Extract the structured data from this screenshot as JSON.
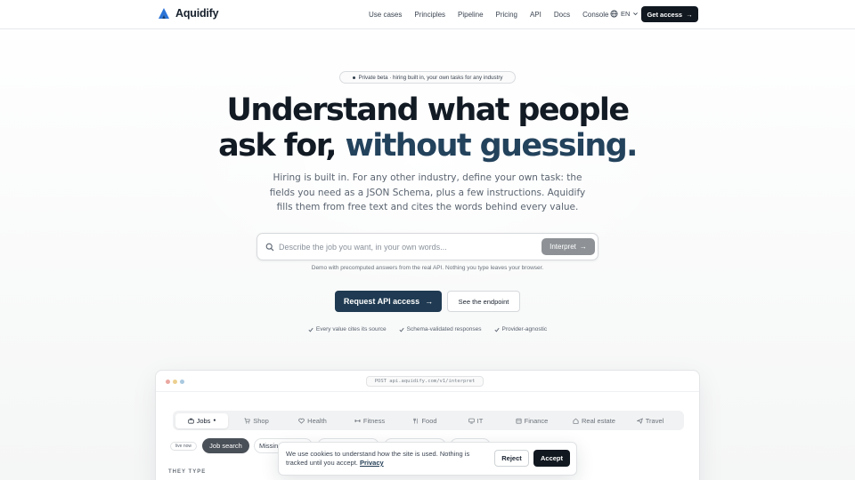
{
  "brand": {
    "name": "Aquidify",
    "color": "#2a74d8"
  },
  "nav": {
    "links": [
      "Use cases",
      "Principles",
      "Pipeline",
      "Pricing",
      "API",
      "Docs",
      "Console"
    ],
    "language": "EN",
    "cta": "Get access"
  },
  "hero": {
    "badge": "Private beta · hiring built in, your own tasks for any industry",
    "title_line1": "Understand what people",
    "title_line2_plain": "ask for, ",
    "title_line2_accent": "without guessing.",
    "subtitle": "Hiring is built in. For any other industry, define your own task: the fields you need as a JSON Schema, plus a few instructions. Aquidify fills them from free text and cites the words behind every value.",
    "search_placeholder": "Describe the job you want, in your own words...",
    "interpret_label": "Interpret",
    "demo_note": "Demo with precomputed answers from the real API. Nothing you type leaves your browser.",
    "primary_cta": "Request API access",
    "secondary_cta": "See the endpoint",
    "checks": [
      "Every value cites its source",
      "Schema-validated responses",
      "Provider-agnostic"
    ]
  },
  "demo": {
    "endpoint": "POST api.aquidify.com/v1/interpret",
    "tabs": [
      {
        "label": "Jobs",
        "icon": "briefcase-icon",
        "active": true
      },
      {
        "label": "Shop",
        "icon": "cart-icon"
      },
      {
        "label": "Health",
        "icon": "heart-icon"
      },
      {
        "label": "Fitness",
        "icon": "dumbbell-icon"
      },
      {
        "label": "Food",
        "icon": "fork-icon"
      },
      {
        "label": "IT",
        "icon": "monitor-icon"
      },
      {
        "label": "Finance",
        "icon": "bank-icon"
      },
      {
        "label": "Real estate",
        "icon": "house-icon"
      },
      {
        "label": "Travel",
        "icon": "plane-icon"
      }
    ],
    "live_tag": "live now",
    "chips": [
      "Job search",
      "Missin"
    ],
    "section_label": "THEY TYPE"
  },
  "cookie": {
    "text": "We use cookies to understand how the site is used. Nothing is tracked until you accept.",
    "privacy_link": "Privacy",
    "reject": "Reject",
    "accept": "Accept"
  }
}
